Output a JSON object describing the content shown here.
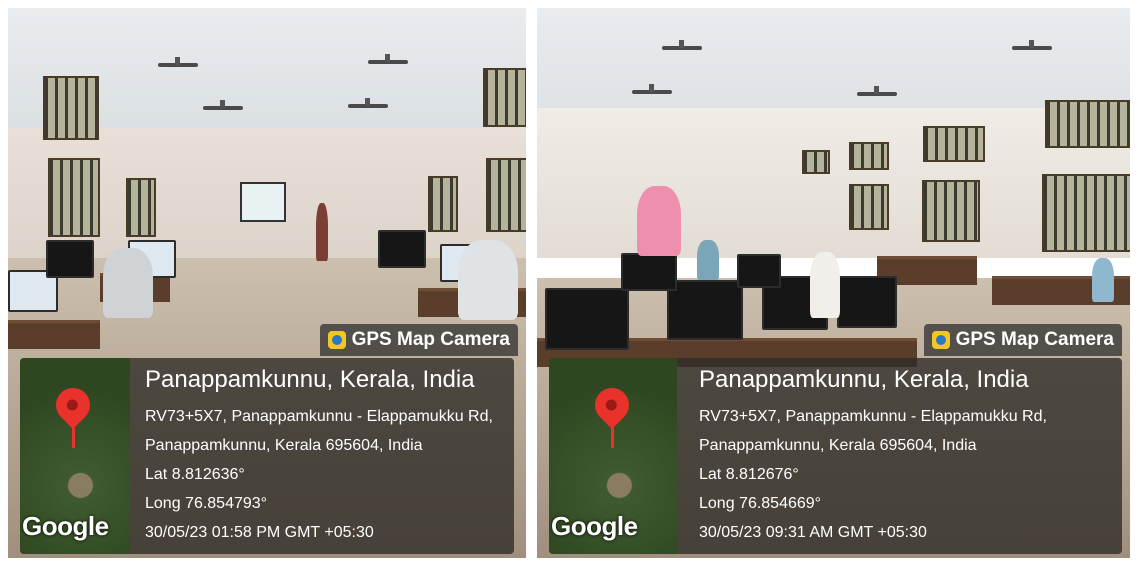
{
  "photos": [
    {
      "overlay_title": "GPS Map Camera",
      "map_logo": "Google",
      "place": "Panappamkunnu, Kerala, India",
      "address_line1": "RV73+5X7, Panappamkunnu - Elappamukku Rd,",
      "address_line2": "Panappamkunnu, Kerala 695604, India",
      "lat": "Lat 8.812636°",
      "long": "Long 76.854793°",
      "timestamp": "30/05/23 01:58 PM GMT +05:30"
    },
    {
      "overlay_title": "GPS Map Camera",
      "map_logo": "Google",
      "place": "Panappamkunnu, Kerala, India",
      "address_line1": "RV73+5X7, Panappamkunnu - Elappamukku Rd,",
      "address_line2": "Panappamkunnu, Kerala 695604, India",
      "lat": "Lat 8.812676°",
      "long": "Long 76.854669°",
      "timestamp": "30/05/23 09:31 AM GMT +05:30"
    }
  ],
  "colors": {
    "pin": "#e8322b",
    "overlay_bg": "#302d28"
  }
}
